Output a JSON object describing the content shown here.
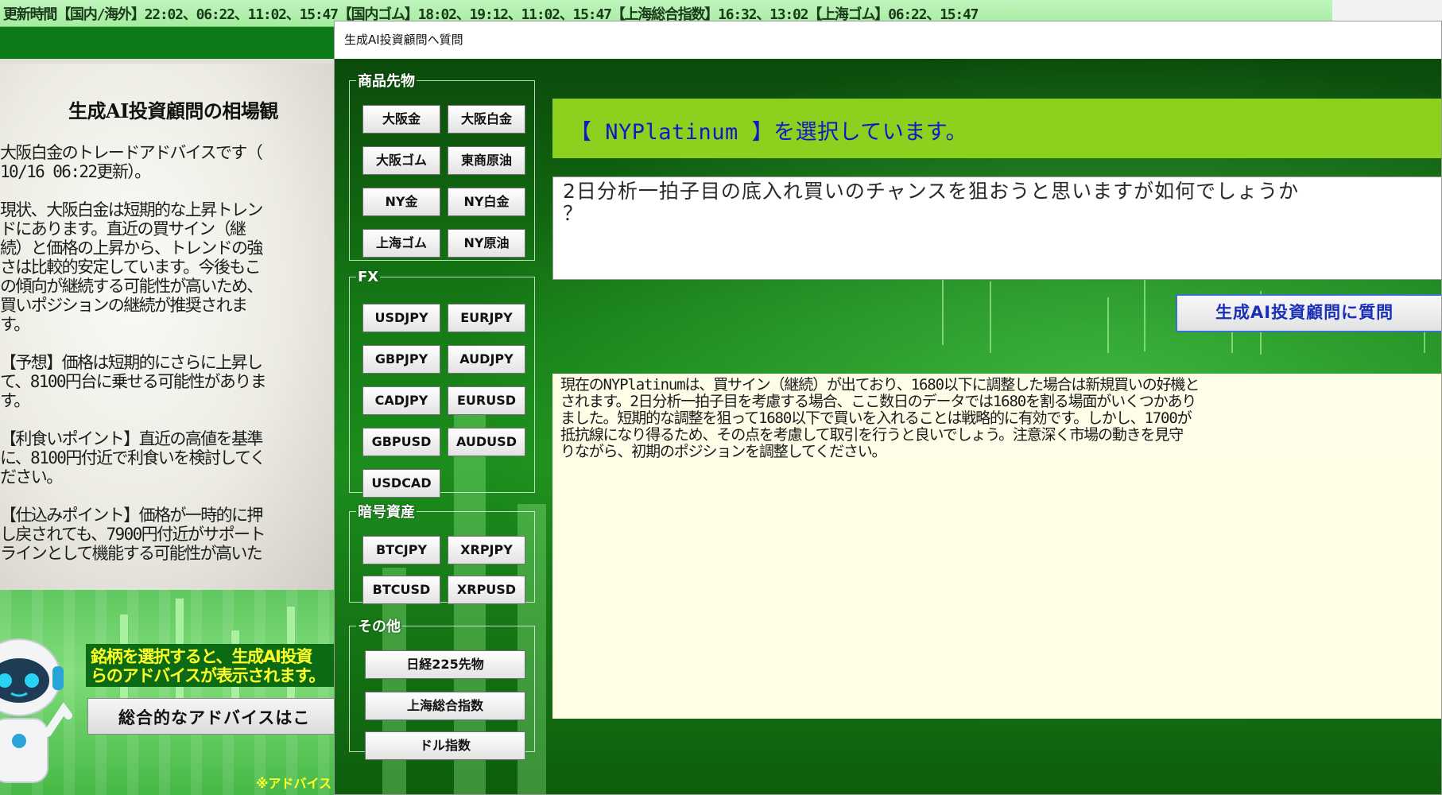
{
  "ticker": {
    "text": "更新時間【国内/海外】22:02、06:22、11:02、15:47【国内ゴム】18:02、19:12、11:02、15:47【上海総合指数】16:32、13:02【上海ゴム】06:22、15:47"
  },
  "left_panel": {
    "title": "生成AI投資顧問の相場観",
    "body": "大阪白金のトレードアドバイスです（\n10/16 06:22更新）。\n\n現状、大阪白金は短期的な上昇トレン\nドにあります。直近の買サイン（継\n続）と価格の上昇から、トレンドの強\nさは比較的安定しています。今後もこ\nの傾向が継続する可能性が高いため、\n買いポジションの継続が推奨されま\nす。\n\n【予想】価格は短期的にさらに上昇し\nて、8100円台に乗せる可能性がありま\nす。\n\n【利食いポイント】直近の高値を基準\nに、8100円付近で利食いを検討してく\nださい。\n\n【仕込みポイント】価格が一時的に押\nし戻されても、7900円付近がサポート\nラインとして機能する可能性が高いた",
    "notice": "銘柄を選択すると、生成AI投資\nらのアドバイスが表示されます。",
    "overall_button": "総合的なアドバイスはこ",
    "footnote": "※アドバイス"
  },
  "dialog": {
    "title": "生成AI投資顧問へ質問",
    "groups": {
      "commodity": {
        "legend": "商品先物",
        "buttons": [
          "大阪金",
          "大阪白金",
          "大阪ゴム",
          "東商原油",
          "NY金",
          "NY白金",
          "上海ゴム",
          "NY原油"
        ]
      },
      "fx": {
        "legend": "FX",
        "buttons": [
          "USDJPY",
          "EURJPY",
          "GBPJPY",
          "AUDJPY",
          "CADJPY",
          "EURUSD",
          "GBPUSD",
          "AUDUSD",
          "USDCAD"
        ]
      },
      "crypto": {
        "legend": "暗号資産",
        "buttons": [
          "BTCJPY",
          "XRPJPY",
          "BTCUSD",
          "XRPUSD"
        ]
      },
      "other": {
        "legend": "その他",
        "buttons": [
          "日経225先物",
          "上海総合指数",
          "ドル指数"
        ]
      }
    },
    "selected_text": "【 NYPlatinum 】を選択しています。",
    "question": "2日分析一拍子目の底入れ買いのチャンスを狙おうと思いますが如何でしょうか\n？",
    "ask_button": "生成AI投資顧問に質問",
    "answer": "現在のNYPlatinumは、買サイン（継続）が出ており、1680以下に調整した場合は新規買いの好機と\nされます。2日分析一拍子目を考慮する場合、ここ数日のデータでは1680を割る場面がいくつかあり\nました。短期的な調整を狙って1680以下で買いを入れることは戦略的に有効です。しかし、1700が\n抵抗線になり得るため、その点を考慮して取引を行うと良いでしょう。注意深く市場の動きを見守\nりながら、初期のポジションを調整してください。"
  },
  "colors": {
    "ticker_bg": "#bff5bd",
    "banner_bg": "#8bd11e",
    "banner_text": "#1515c8",
    "ask_border": "#3b6fd6",
    "answer_bg": "#ffffe6",
    "notice_text": "#ffff28"
  }
}
